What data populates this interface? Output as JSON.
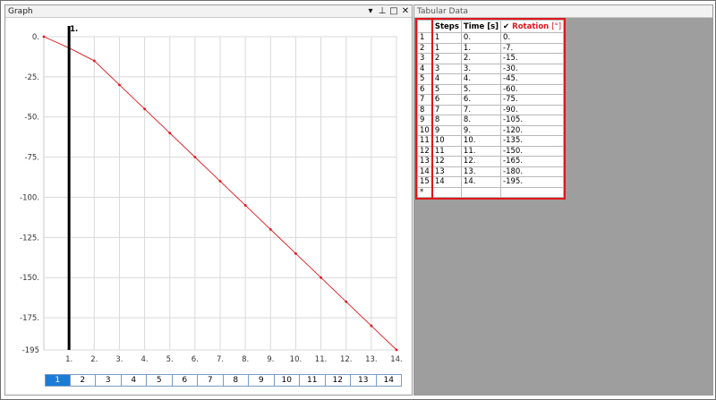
{
  "graph_panel": {
    "title": "Graph",
    "controls": {
      "dropdown": "▾",
      "pin": "⊥",
      "maximize": "□",
      "close": "✕"
    },
    "step_tabs": [
      "1",
      "2",
      "3",
      "4",
      "5",
      "6",
      "7",
      "8",
      "9",
      "10",
      "11",
      "12",
      "13",
      "14"
    ],
    "active_tab": "1",
    "cursor_label": "1."
  },
  "tabular_panel": {
    "title": "Tabular Data",
    "columns": {
      "steps": "Steps",
      "time": "Time [s]",
      "rotation": "Rotation",
      "rotation_unit": "[°]",
      "check": "✔"
    },
    "rows": [
      {
        "idx": "1",
        "steps": "1",
        "time": "0.",
        "rotation": "0."
      },
      {
        "idx": "2",
        "steps": "1",
        "time": "1.",
        "rotation": "-7."
      },
      {
        "idx": "3",
        "steps": "2",
        "time": "2.",
        "rotation": "-15."
      },
      {
        "idx": "4",
        "steps": "3",
        "time": "3.",
        "rotation": "-30."
      },
      {
        "idx": "5",
        "steps": "4",
        "time": "4.",
        "rotation": "-45."
      },
      {
        "idx": "6",
        "steps": "5",
        "time": "5.",
        "rotation": "-60."
      },
      {
        "idx": "7",
        "steps": "6",
        "time": "6.",
        "rotation": "-75."
      },
      {
        "idx": "8",
        "steps": "7",
        "time": "7.",
        "rotation": "-90."
      },
      {
        "idx": "9",
        "steps": "8",
        "time": "8.",
        "rotation": "-105."
      },
      {
        "idx": "10",
        "steps": "9",
        "time": "9.",
        "rotation": "-120."
      },
      {
        "idx": "11",
        "steps": "10",
        "time": "10.",
        "rotation": "-135."
      },
      {
        "idx": "12",
        "steps": "11",
        "time": "11.",
        "rotation": "-150."
      },
      {
        "idx": "13",
        "steps": "12",
        "time": "12.",
        "rotation": "-165."
      },
      {
        "idx": "14",
        "steps": "13",
        "time": "13.",
        "rotation": "-180."
      },
      {
        "idx": "15",
        "steps": "14",
        "time": "14.",
        "rotation": "-195."
      }
    ],
    "new_row_marker": "*"
  },
  "chart_data": {
    "type": "line",
    "x": [
      0,
      1,
      2,
      3,
      4,
      5,
      6,
      7,
      8,
      9,
      10,
      11,
      12,
      13,
      14
    ],
    "series": [
      {
        "values": [
          0,
          -7,
          -15,
          -30,
          -45,
          -60,
          -75,
          -90,
          -105,
          -120,
          -135,
          -150,
          -165,
          -180,
          -195
        ],
        "color": "#e0161c"
      }
    ],
    "xticks": [
      "1.",
      "2.",
      "3.",
      "4.",
      "5.",
      "6.",
      "7.",
      "8.",
      "9.",
      "10.",
      "11.",
      "12.",
      "13.",
      "14."
    ],
    "yticks": [
      "0.",
      "-25.",
      "-50.",
      "-75.",
      "-100.",
      "-125.",
      "-150.",
      "-175.",
      "-195"
    ],
    "ytick_values": [
      0,
      -25,
      -50,
      -75,
      -100,
      -125,
      -150,
      -175,
      -195
    ],
    "xlim": [
      0,
      14
    ],
    "ylim": [
      -195,
      0
    ],
    "cursor_x": 1,
    "cursor_color": "#000000",
    "grid": true
  }
}
